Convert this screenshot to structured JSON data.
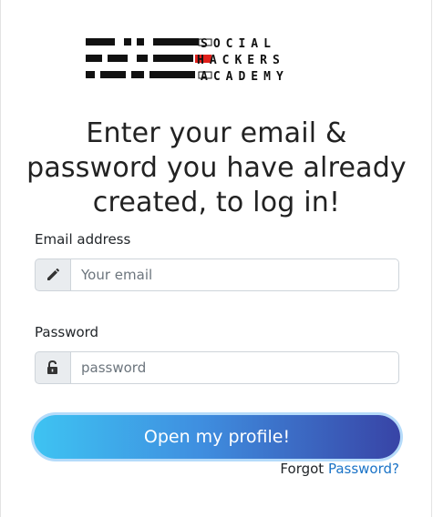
{
  "logo": {
    "line1": "SOCIAL",
    "line2": "HACKERS",
    "line3": "ACADEMY",
    "accent_color": "#e0201b"
  },
  "heading": "Enter your email & password you have already created, to log in!",
  "email": {
    "label": "Email address",
    "placeholder": "Your email",
    "icon": "pencil-icon"
  },
  "password": {
    "label": "Password",
    "placeholder": "password",
    "icon": "lock-icon"
  },
  "submit_label": "Open my profile!",
  "forgot": {
    "prefix": "Forgot",
    "link": "Password?"
  },
  "colors": {
    "button_start": "#3ec3f2",
    "button_end": "#3844a6",
    "link": "#1a73c7"
  }
}
